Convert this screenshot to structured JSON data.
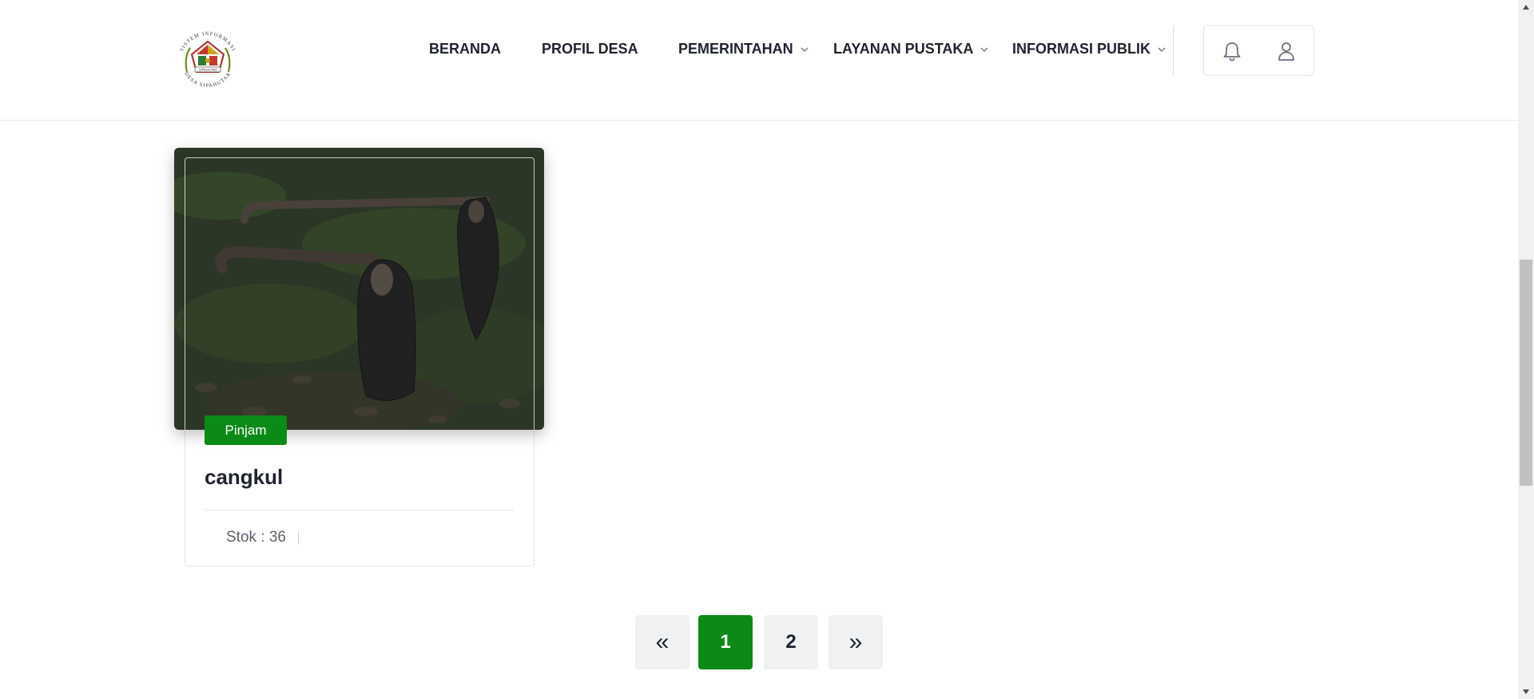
{
  "header": {
    "logo_text_top": "SISTEM INFORMASI",
    "logo_text_bottom": "DESA SIPAHUTAR",
    "logo_banner": "SIPAHUTAR",
    "nav": [
      {
        "label": "BERANDA",
        "dropdown": false
      },
      {
        "label": "PROFIL DESA",
        "dropdown": false
      },
      {
        "label": "PEMERINTAHAN",
        "dropdown": true
      },
      {
        "label": "LAYANAN PUSTAKA",
        "dropdown": true
      },
      {
        "label": "INFORMASI PUBLIK",
        "dropdown": true
      }
    ],
    "icons": [
      "bell-icon",
      "user-icon"
    ]
  },
  "card": {
    "badge": "Pinjam",
    "title": "cangkul",
    "stock": "Stok : 36",
    "image": "photo of two hoes on grass"
  },
  "pagination": {
    "prev": "«",
    "pages": [
      "1",
      "2"
    ],
    "current": "1",
    "next": "»"
  },
  "colors": {
    "accent": "#0c8a17",
    "text": "#1f2230",
    "muted": "#5d6170",
    "button_bg": "#f0f1f3"
  }
}
